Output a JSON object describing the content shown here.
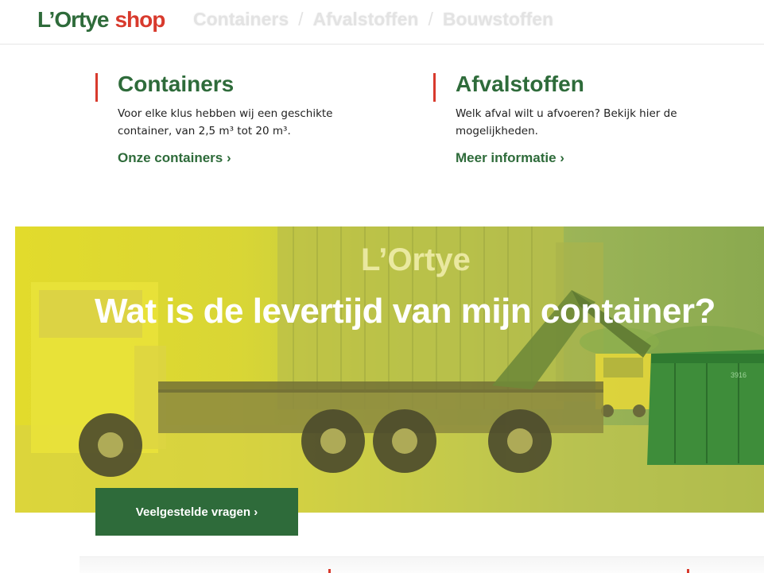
{
  "header": {
    "logo_brand": "L’Ortye",
    "logo_shop": "shop",
    "nav": [
      {
        "label": "Containers"
      },
      {
        "label": "Afvalstoffen"
      },
      {
        "label": "Bouwstoffen"
      }
    ],
    "separator": "/"
  },
  "features": {
    "containers": {
      "title": "Containers",
      "text": "Voor elke klus hebben wij een geschikte container, van 2,5 m³ tot 20 m³.",
      "link": "Onze containers ›"
    },
    "afvalstoffen": {
      "title": "Afvalstoffen",
      "text": "Welk afval wilt u afvoeren? Bekijk hier de mogelijkheden.",
      "link": "Meer informatie ›"
    }
  },
  "hero": {
    "heading": "Wat is de levertijd van mijn container?",
    "building_logo": "L’Ortye",
    "container_tag": "3916",
    "cta_label": "Veelgestelde vragen ›"
  },
  "colors": {
    "brand_green": "#2e6b3a",
    "brand_red": "#d83a2d",
    "hero_yellow": "#e2db2c"
  }
}
